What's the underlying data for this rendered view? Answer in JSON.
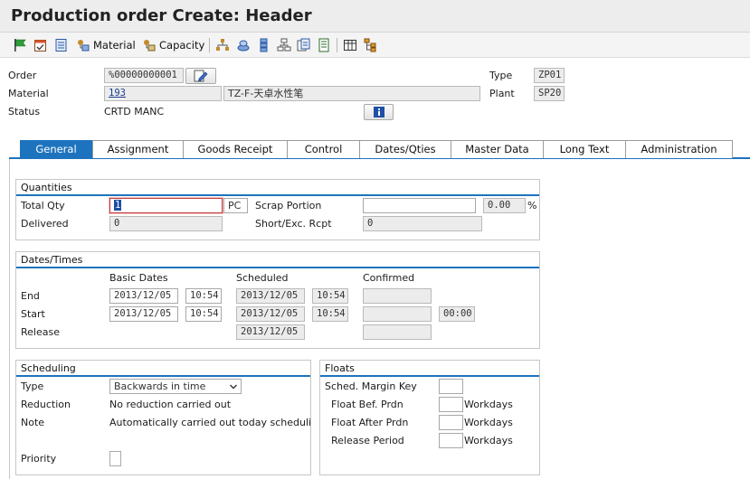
{
  "window": {
    "title": "Production order Create: Header"
  },
  "toolbar": {
    "material_label": "Material",
    "capacity_label": "Capacity"
  },
  "header": {
    "order_label": "Order",
    "order_value": "%00000000001",
    "material_label": "Material",
    "material_value": "193",
    "material_desc": "TZ-F-天卓水性笔",
    "status_label": "Status",
    "status_value": "CRTD MANC",
    "type_label": "Type",
    "type_value": "ZP01",
    "plant_label": "Plant",
    "plant_value": "SP20"
  },
  "tabs": [
    {
      "label": "General"
    },
    {
      "label": "Assignment"
    },
    {
      "label": "Goods Receipt"
    },
    {
      "label": "Control"
    },
    {
      "label": "Dates/Qties"
    },
    {
      "label": "Master Data"
    },
    {
      "label": "Long Text"
    },
    {
      "label": "Administration"
    }
  ],
  "quantities": {
    "title": "Quantities",
    "total_qty_label": "Total Qty",
    "total_qty_value": "1",
    "unit": "PC",
    "scrap_label": "Scrap Portion",
    "scrap_value": "",
    "scrap_pct": "0.00",
    "pct_sign": "%",
    "delivered_label": "Delivered",
    "delivered_value": "0",
    "short_label": "Short/Exc. Rcpt",
    "short_value": "0"
  },
  "dates": {
    "title": "Dates/Times",
    "col_basic": "Basic Dates",
    "col_scheduled": "Scheduled",
    "col_confirmed": "Confirmed",
    "end_label": "End",
    "start_label": "Start",
    "release_label": "Release",
    "end_basic_date": "2013/12/05",
    "end_basic_time": "10:54",
    "end_sched_date": "2013/12/05",
    "end_sched_time": "10:54",
    "start_basic_date": "2013/12/05",
    "start_basic_time": "10:54",
    "start_sched_date": "2013/12/05",
    "start_sched_time": "10:54",
    "start_conf_time": "00:00",
    "release_sched_date": "2013/12/05"
  },
  "scheduling": {
    "title": "Scheduling",
    "type_label": "Type",
    "type_value": "Backwards in time",
    "reduction_label": "Reduction",
    "reduction_value": "No reduction carried out",
    "note_label": "Note",
    "note_value": "Automatically carried out today schedulin",
    "priority_label": "Priority"
  },
  "floats": {
    "title": "Floats",
    "margin_key_label": "Sched. Margin Key",
    "float_bef_label": "Float Bef. Prdn",
    "float_after_label": "Float After Prdn",
    "release_period_label": "Release Period",
    "unit_label": "Workdays"
  },
  "colors": {
    "accent": "#1e73be",
    "field_bg": "#ececec",
    "title_bg": "#ededed"
  }
}
